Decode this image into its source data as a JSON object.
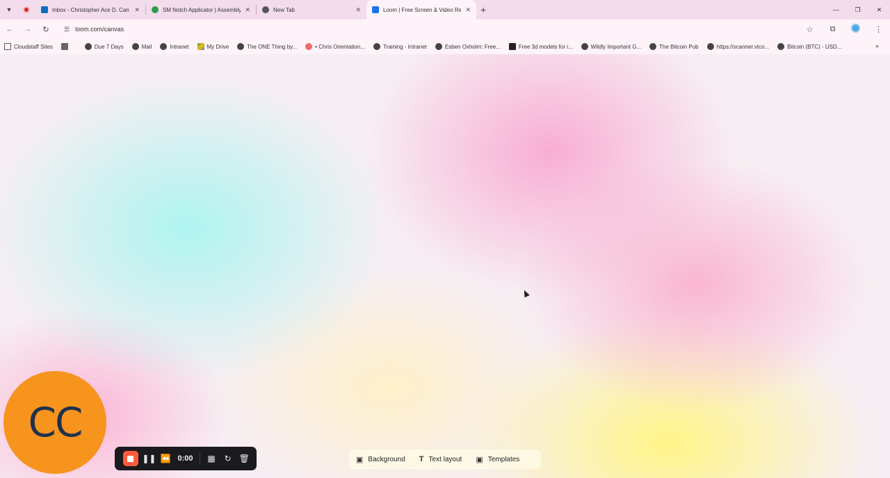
{
  "browser": {
    "tabs": [
      {
        "title": "Inbox - Christopher Ace D. Can",
        "favicon": "outlook-icon",
        "color": "#0f6cbd",
        "active": false
      },
      {
        "title": "SM Notch Applicator | Assembly",
        "favicon": "gear-icon",
        "color": "#2e9b4a",
        "active": false
      },
      {
        "title": "New Tab",
        "favicon": "chrome-icon",
        "color": "#555555",
        "active": false
      },
      {
        "title": "Loom | Free Screen & Video Re",
        "favicon": "loom-icon",
        "color": "#1a73e8",
        "active": true
      }
    ],
    "url": "loom.com/canvas",
    "bookmarks": [
      {
        "label": "Cloudstaff Sites",
        "icon": "folder-icon"
      },
      {
        "label": "",
        "icon": "apps-grid-icon"
      },
      {
        "label": "Due 7 Days",
        "icon": "globe-icon"
      },
      {
        "label": "Mail",
        "icon": "globe-icon"
      },
      {
        "label": "Intranet",
        "icon": "globe-icon"
      },
      {
        "label": "My Drive",
        "icon": "drive-icon"
      },
      {
        "label": "The ONE Thing by...",
        "icon": "globe-icon"
      },
      {
        "label": "• Chris Orientation...",
        "icon": "asana-icon"
      },
      {
        "label": "Training - Intranet",
        "icon": "globe-icon"
      },
      {
        "label": "Esben Oxholm: Free...",
        "icon": "globe-icon"
      },
      {
        "label": "Free 3d models for i...",
        "icon": "sketchfab-icon"
      },
      {
        "label": "Wildly Important G...",
        "icon": "globe-icon"
      },
      {
        "label": "The Bitcoin Pub",
        "icon": "globe-icon"
      },
      {
        "label": "https://scanner.vtco...",
        "icon": "globe-icon"
      },
      {
        "label": "Bitcoin (BTC) - USD...",
        "icon": "globe-icon"
      }
    ]
  },
  "camera": {
    "initials": "CC",
    "color": "#f7941d"
  },
  "recorder": {
    "timer": "0:00",
    "stop_color": "#ff5b3d"
  },
  "tools": [
    {
      "label": "Background",
      "icon": "image-icon"
    },
    {
      "label": "Text layout",
      "icon": "text-icon"
    },
    {
      "label": "Templates",
      "icon": "monitor-icon"
    }
  ]
}
